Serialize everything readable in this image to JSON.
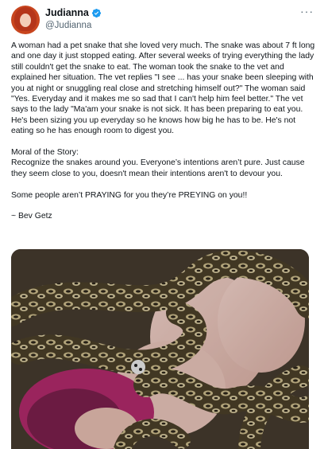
{
  "author": {
    "display_name": "Judianna",
    "handle": "@Judianna",
    "avatar_icon": "profile-photo",
    "verified_icon": "verified-badge-icon",
    "verified_color": "#1d9bf0"
  },
  "menu_icon": "more-options-icon",
  "tweet": {
    "paragraph_1": "A woman had a pet snake that she loved very much. The snake was about 7 ft long and one day it just stopped eating. After several weeks of trying everything the lady still couldn't get the snake to eat. The woman took the snake to the vet and explained her situation. The vet replies \"I see ... has your snake been sleeping with you at night or snuggling real close and stretching himself out?\" The woman said \"Yes. Everyday and it makes me so sad that I can't help him feel better.\" The vet says to the lady \"Ma'am your snake is not sick. It has been preparing to eat you. He's been sizing you up everyday so he knows how big he has to be. He's not eating so he has enough room to digest you.",
    "moral_heading": "Moral of the Story:",
    "moral_text": "Recognize the snakes around you. Everyone’s intentions aren’t pure. Just cause they seem close to you, doesn't mean their intentions aren't to devour you.",
    "closing_line": "Some people aren’t PRAYING for you they’re PREYING on you!!",
    "signature": "~ Bev Getz"
  },
  "media": {
    "icon": "photo-woman-with-python"
  }
}
